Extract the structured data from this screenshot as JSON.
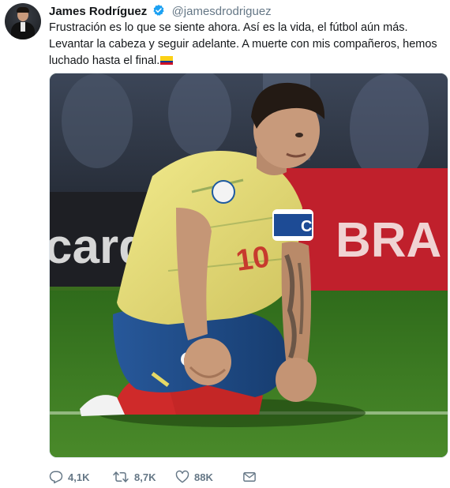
{
  "user": {
    "name": "James Rodríguez",
    "handle": "@jamesdrodriguez",
    "verified": true
  },
  "tweet": {
    "text": "Frustración es lo que se siente ahora. Así es la vida, el fútbol aún más. Levantar la cabeza y seguir adelante. A muerte con mis compañeros, hemos luchado hasta el final.",
    "flag_icon": "colombia-flag-icon"
  },
  "media": {
    "banner_left_text": "card",
    "banner_right_text": "BRA",
    "jersey_number": "10",
    "armband_text": "C"
  },
  "actions": {
    "replies": "4,1K",
    "retweets": "8,7K",
    "likes": "88K"
  },
  "colors": {
    "accent": "#1da1f2",
    "secondary_text": "#657786",
    "jersey_yellow": "#e8df7a",
    "shorts_blue": "#1f4e8c",
    "banner_red": "#c0202c"
  }
}
